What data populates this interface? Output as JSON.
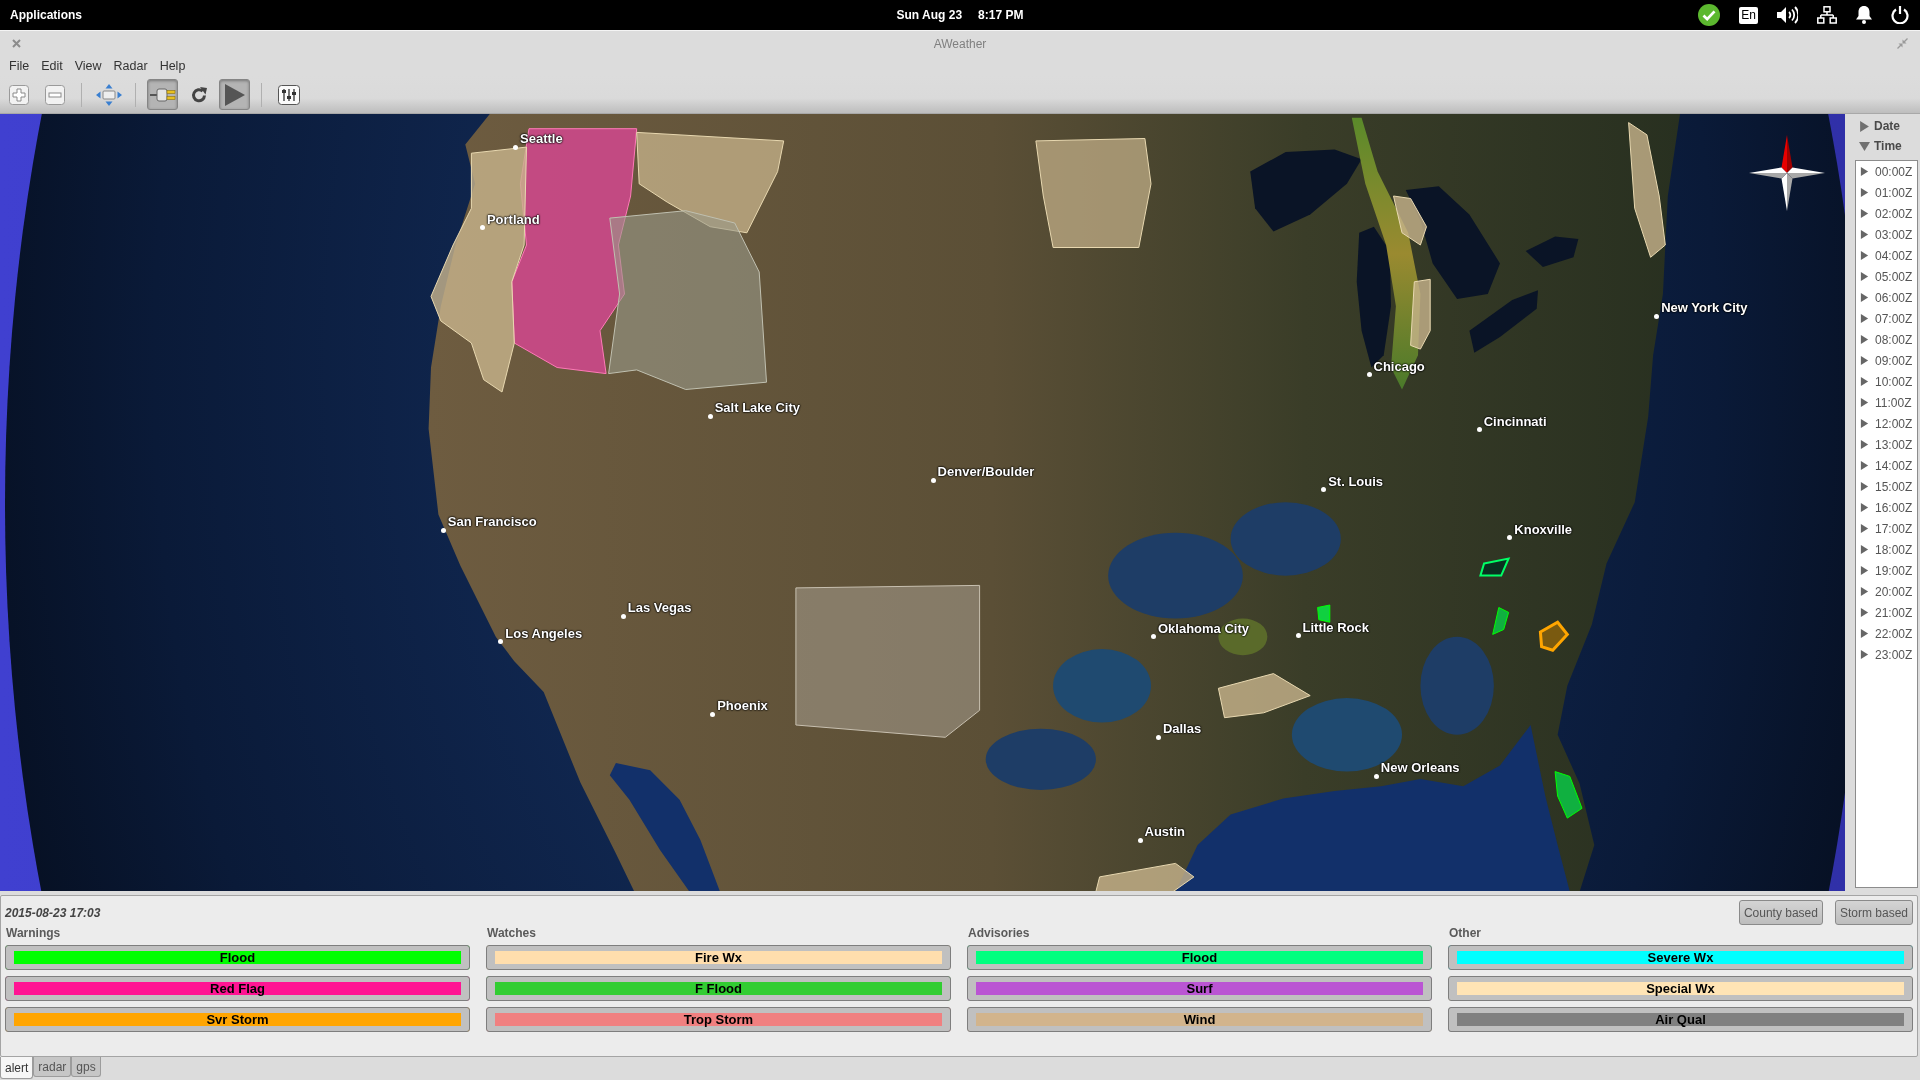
{
  "top_bar": {
    "menu": "Applications",
    "date": "Sun Aug 23",
    "time": "8:17 PM",
    "tray": [
      {
        "kind": "status"
      },
      {
        "kind": "keyboard",
        "label": "En"
      },
      {
        "kind": "volume"
      },
      {
        "kind": "network"
      },
      {
        "kind": "notifications"
      },
      {
        "kind": "power"
      }
    ]
  },
  "window": {
    "title": "AWeather"
  },
  "menu": [
    "File",
    "Edit",
    "View",
    "Radar",
    "Help"
  ],
  "toolbar": [
    {
      "kind": "zoom_in",
      "active": false
    },
    {
      "kind": "zoom_out",
      "active": false
    },
    {
      "kind": "separator"
    },
    {
      "kind": "pan",
      "active": false
    },
    {
      "kind": "separator"
    },
    {
      "kind": "connect",
      "active": true
    },
    {
      "kind": "refresh",
      "active": false
    },
    {
      "kind": "play",
      "active": true
    },
    {
      "kind": "separator"
    },
    {
      "kind": "settings",
      "active": false
    }
  ],
  "map": {
    "cities": [
      "Seattle",
      "Portland",
      "New York City",
      "Chicago",
      "Salt Lake City",
      "Cincinnati",
      "Denver/Boulder",
      "St. Louis",
      "San Francisco",
      "Knoxville",
      "Las Vegas",
      "Oklahoma City",
      "Little Rock",
      "Los Angeles",
      "Phoenix",
      "Dallas",
      "New Orleans",
      "Austin"
    ]
  },
  "sidebar": {
    "sections": [
      {
        "label": "Date",
        "expanded": false
      },
      {
        "label": "Time",
        "expanded": true,
        "children": [
          {
            "label": "00:00Z",
            "expanded": false
          },
          {
            "label": "01:00Z",
            "expanded": false
          },
          {
            "label": "02:00Z",
            "expanded": false
          },
          {
            "label": "03:00Z",
            "expanded": false
          },
          {
            "label": "04:00Z",
            "expanded": false
          },
          {
            "label": "05:00Z",
            "expanded": false
          },
          {
            "label": "06:00Z",
            "expanded": false
          },
          {
            "label": "07:00Z",
            "expanded": false
          },
          {
            "label": "08:00Z",
            "expanded": false
          },
          {
            "label": "09:00Z",
            "expanded": false
          },
          {
            "label": "10:00Z",
            "expanded": false
          },
          {
            "label": "11:00Z",
            "expanded": false
          },
          {
            "label": "12:00Z",
            "expanded": false
          },
          {
            "label": "13:00Z",
            "expanded": false
          },
          {
            "label": "14:00Z",
            "expanded": false
          },
          {
            "label": "15:00Z",
            "expanded": false
          },
          {
            "label": "16:00Z",
            "expanded": false
          },
          {
            "label": "17:00Z",
            "expanded": false
          },
          {
            "label": "18:00Z",
            "expanded": false
          },
          {
            "label": "19:00Z",
            "expanded": false
          },
          {
            "label": "20:00Z",
            "expanded": false
          },
          {
            "label": "21:00Z",
            "expanded": false
          },
          {
            "label": "22:00Z",
            "expanded": false
          },
          {
            "label": "23:00Z",
            "expanded": false
          }
        ]
      }
    ]
  },
  "alerts": {
    "timestamp": "2015-08-23 17:03",
    "modes": [
      "County based",
      "Storm based"
    ],
    "groups": [
      {
        "title": "Warnings",
        "items": [
          {
            "label": "Flood",
            "color": "#00ff00"
          },
          {
            "label": "Red Flag",
            "color": "#ff1493"
          },
          {
            "label": "Svr Storm",
            "color": "#ffa500"
          }
        ]
      },
      {
        "title": "Watches",
        "items": [
          {
            "label": "Fire Wx",
            "color": "#ffdead"
          },
          {
            "label": "F Flood",
            "color": "#32cd32"
          },
          {
            "label": "Trop Storm",
            "color": "#f08080"
          }
        ]
      },
      {
        "title": "Advisories",
        "items": [
          {
            "label": "Flood",
            "color": "#00ff7f"
          },
          {
            "label": "Surf",
            "color": "#ba55d3"
          },
          {
            "label": "Wind",
            "color": "#d2b48c"
          }
        ]
      },
      {
        "title": "Other",
        "items": [
          {
            "label": "Severe Wx",
            "color": "#00ffff"
          },
          {
            "label": "Special Wx",
            "color": "#ffe4b5"
          },
          {
            "label": "Air Qual",
            "color": "#808080"
          }
        ]
      }
    ]
  },
  "tabs": [
    {
      "label": "alert",
      "selected": true
    },
    {
      "label": "radar",
      "selected": false
    },
    {
      "label": "gps",
      "selected": false
    }
  ]
}
